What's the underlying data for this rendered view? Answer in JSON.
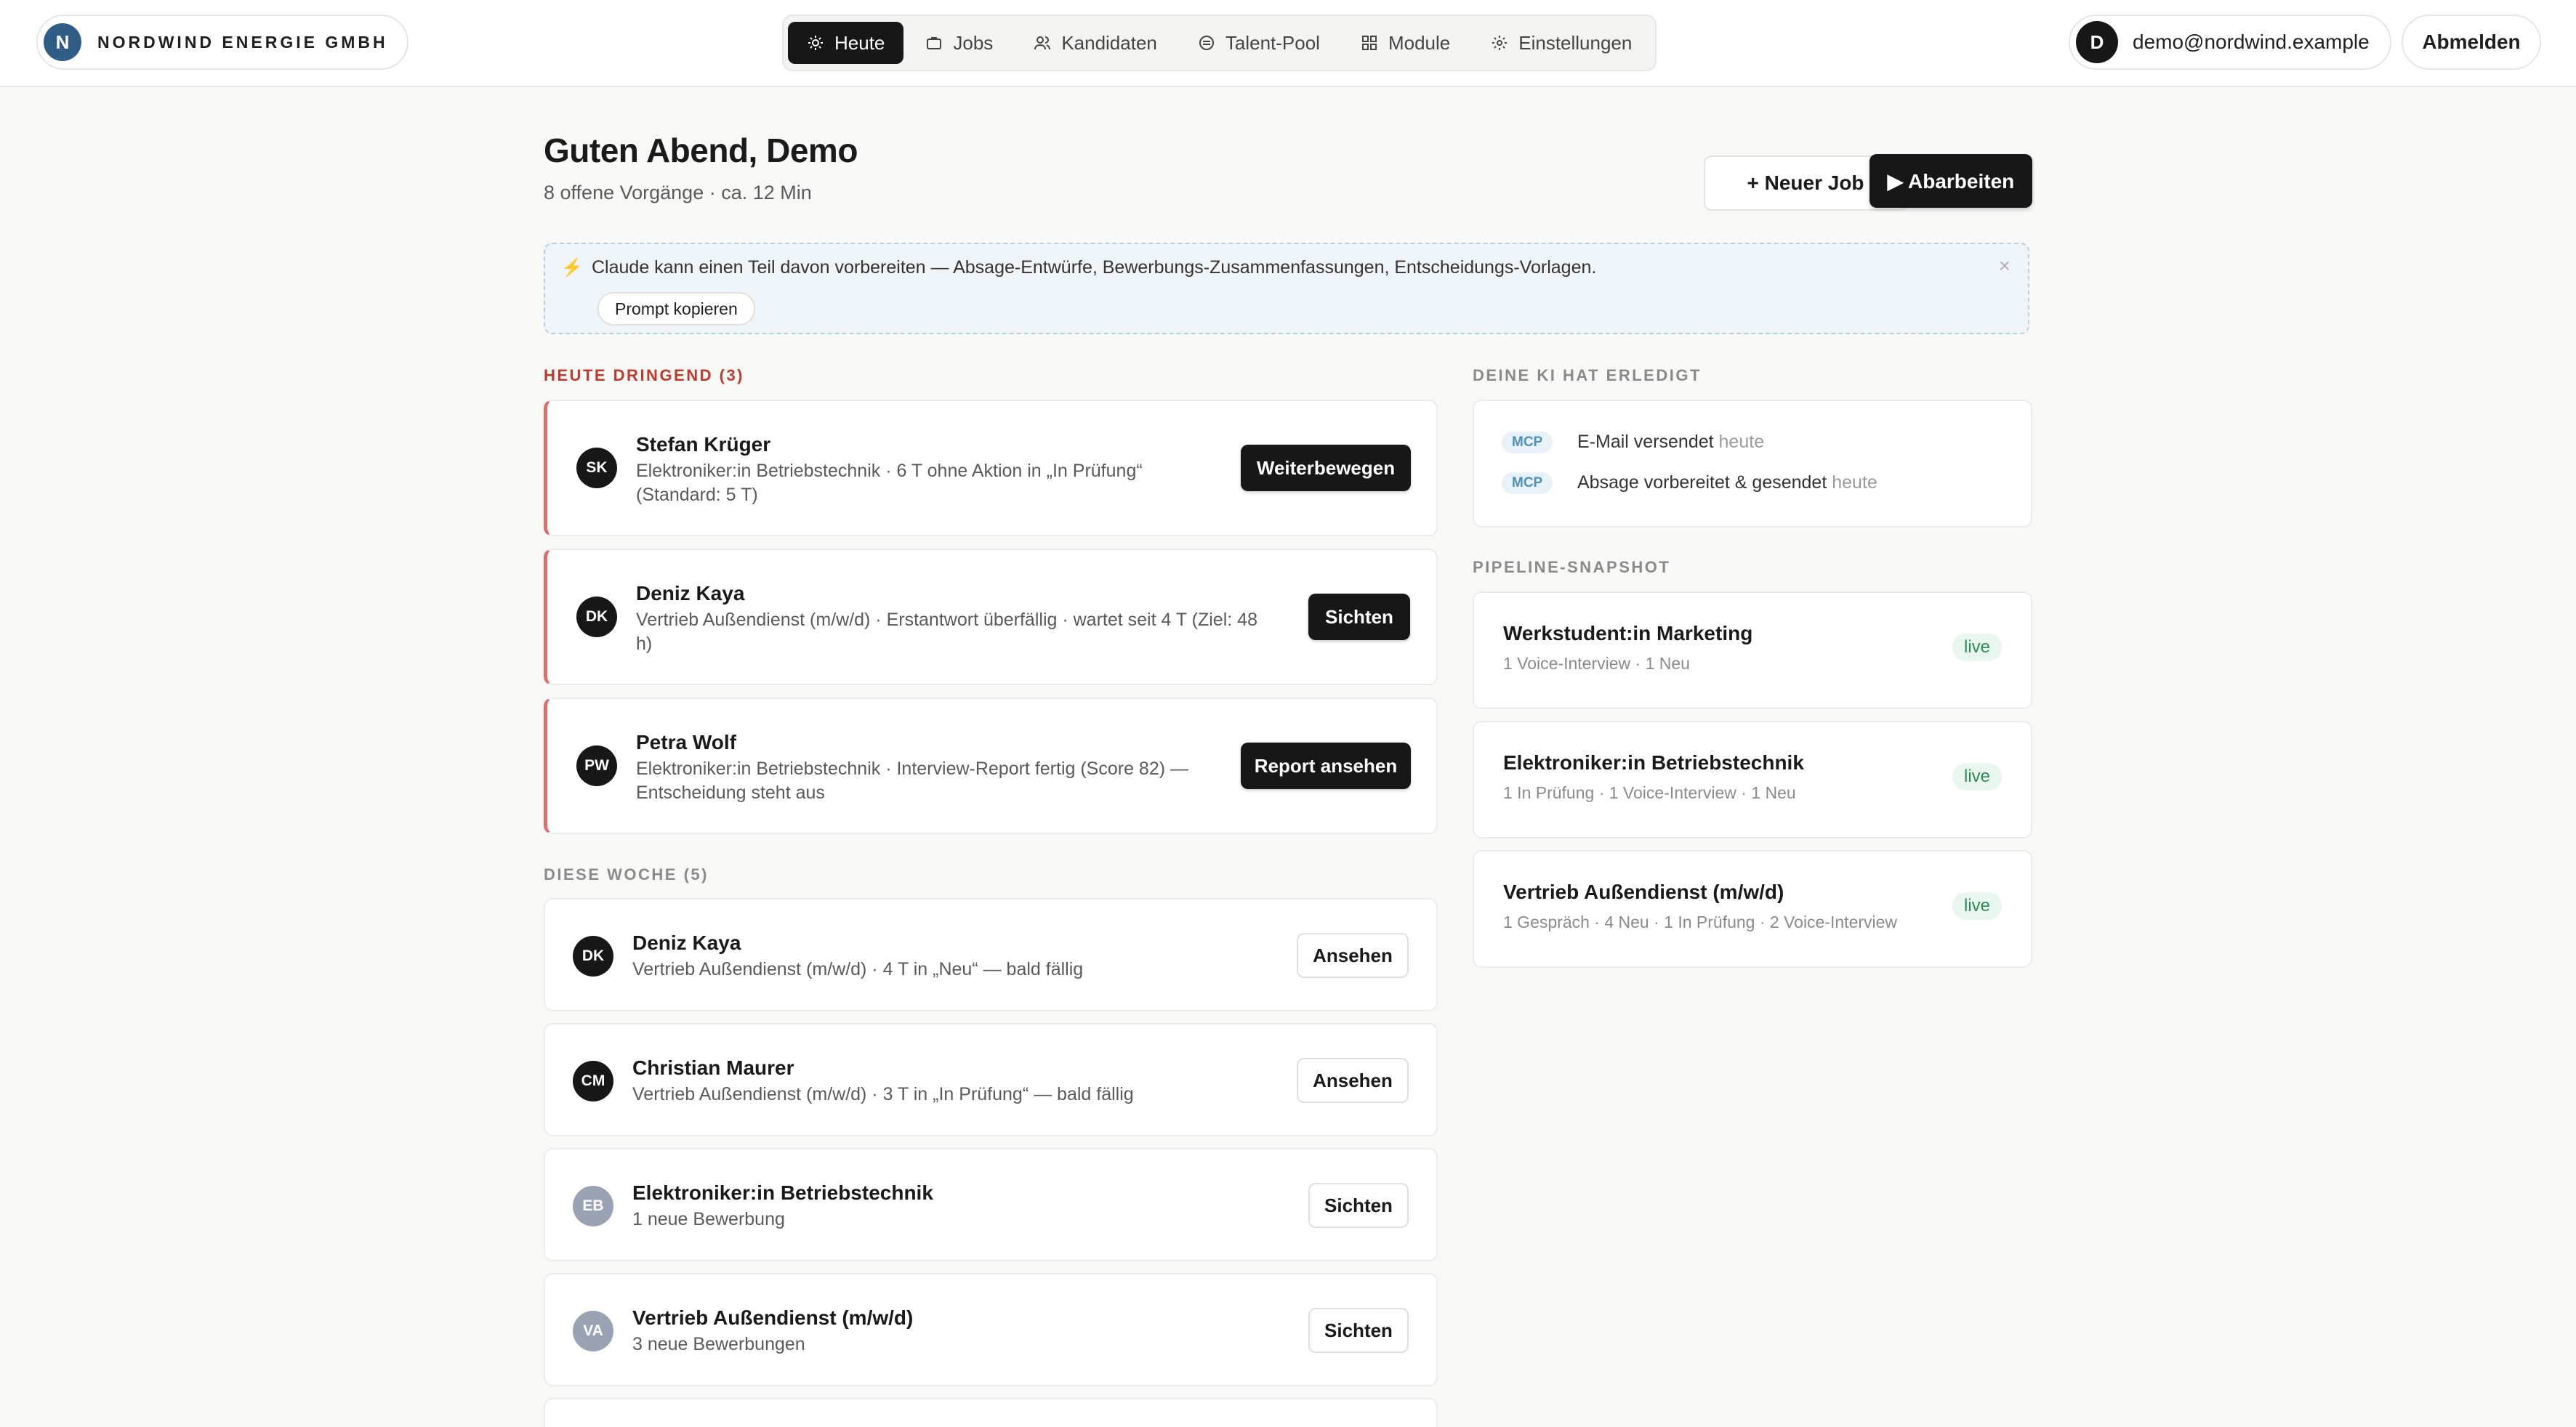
{
  "brand": {
    "logo_letter": "N",
    "name": "NORDWIND ENERGIE GMBH"
  },
  "nav": {
    "items": [
      {
        "label": "Heute",
        "icon": "sun-icon",
        "active": true
      },
      {
        "label": "Jobs",
        "icon": "briefcase-icon",
        "active": false
      },
      {
        "label": "Kandidaten",
        "icon": "users-icon",
        "active": false
      },
      {
        "label": "Talent-Pool",
        "icon": "pool-icon",
        "active": false
      },
      {
        "label": "Module",
        "icon": "grid-icon",
        "active": false
      },
      {
        "label": "Einstellungen",
        "icon": "gear-icon",
        "active": false
      }
    ]
  },
  "user": {
    "avatar_letter": "D",
    "email": "demo@nordwind.example",
    "logout_label": "Abmelden"
  },
  "header": {
    "greeting": "Guten Abend, Demo",
    "subline": "8 offene Vorgänge · ca. 12 Min",
    "new_job_label": "+ Neuer Job",
    "process_label": "▶ Abarbeiten"
  },
  "banner": {
    "icon": "⚡",
    "text": "Claude kann einen Teil davon vorbereiten — Absage-Entwürfe, Bewerbungs-Zusammenfassungen, Entscheidungs-Vorlagen.",
    "copy_label": "Prompt kopieren",
    "close_icon": "×"
  },
  "urgent": {
    "label": "HEUTE DRINGEND (3)",
    "items": [
      {
        "initials": "SK",
        "name": "Stefan Krüger",
        "desc1": "Elektroniker:in Betriebstechnik · 6 T ohne Aktion in „In Prüfung“",
        "desc2": "(Standard: 5 T)",
        "action": "Weiterbewegen"
      },
      {
        "initials": "DK",
        "name": "Deniz Kaya",
        "desc1": "Vertrieb Außendienst (m/w/d) · Erstantwort überfällig · wartet seit 4 T (Ziel: 48",
        "desc2": "h)",
        "action": "Sichten"
      },
      {
        "initials": "PW",
        "name": "Petra Wolf",
        "desc1": "Elektroniker:in Betriebstechnik · Interview-Report fertig (Score 82) —",
        "desc2": "Entscheidung steht aus",
        "action": "Report ansehen"
      }
    ]
  },
  "week": {
    "label": "DIESE WOCHE (5)",
    "items": [
      {
        "initials": "DK",
        "name": "Deniz Kaya",
        "desc": "Vertrieb Außendienst (m/w/d) · 4 T in „Neu“ — bald fällig",
        "action": "Ansehen"
      },
      {
        "initials": "CM",
        "name": "Christian Maurer",
        "desc": "Vertrieb Außendienst (m/w/d) · 3 T in „In Prüfung“ — bald fällig",
        "action": "Ansehen"
      },
      {
        "initials": "EB",
        "name": "Elektroniker:in Betriebstechnik",
        "desc": "1 neue Bewerbung",
        "action": "Sichten"
      },
      {
        "initials": "VA",
        "name": "Vertrieb Außendienst (m/w/d)",
        "desc": "3 neue Bewerbungen",
        "action": "Sichten"
      }
    ]
  },
  "ai_done": {
    "label": "DEINE KI HAT ERLEDIGT",
    "items": [
      {
        "badge": "MCP",
        "text": "E-Mail versendet",
        "when": "heute"
      },
      {
        "badge": "MCP",
        "text": "Absage vorbereitet & gesendet",
        "when": "heute"
      }
    ]
  },
  "pipeline": {
    "label": "PIPELINE-SNAPSHOT",
    "items": [
      {
        "title": "Werkstudent:in Marketing",
        "sub": "1 Voice-Interview · 1 Neu",
        "status": "live"
      },
      {
        "title": "Elektroniker:in Betriebstechnik",
        "sub": "1 In Prüfung · 1 Voice-Interview · 1 Neu",
        "status": "live"
      },
      {
        "title": "Vertrieb Außendienst (m/w/d)",
        "sub": "1 Gespräch · 4 Neu · 1 In Prüfung · 2 Voice-Interview",
        "status": "live"
      }
    ]
  },
  "colors": {
    "accent": "#171717",
    "urgent": "#c0392b",
    "urgent_border": "#e06b6b",
    "live": "#2e8b57",
    "mcp": "#4f8fb8",
    "brand": "#2f5d86"
  }
}
